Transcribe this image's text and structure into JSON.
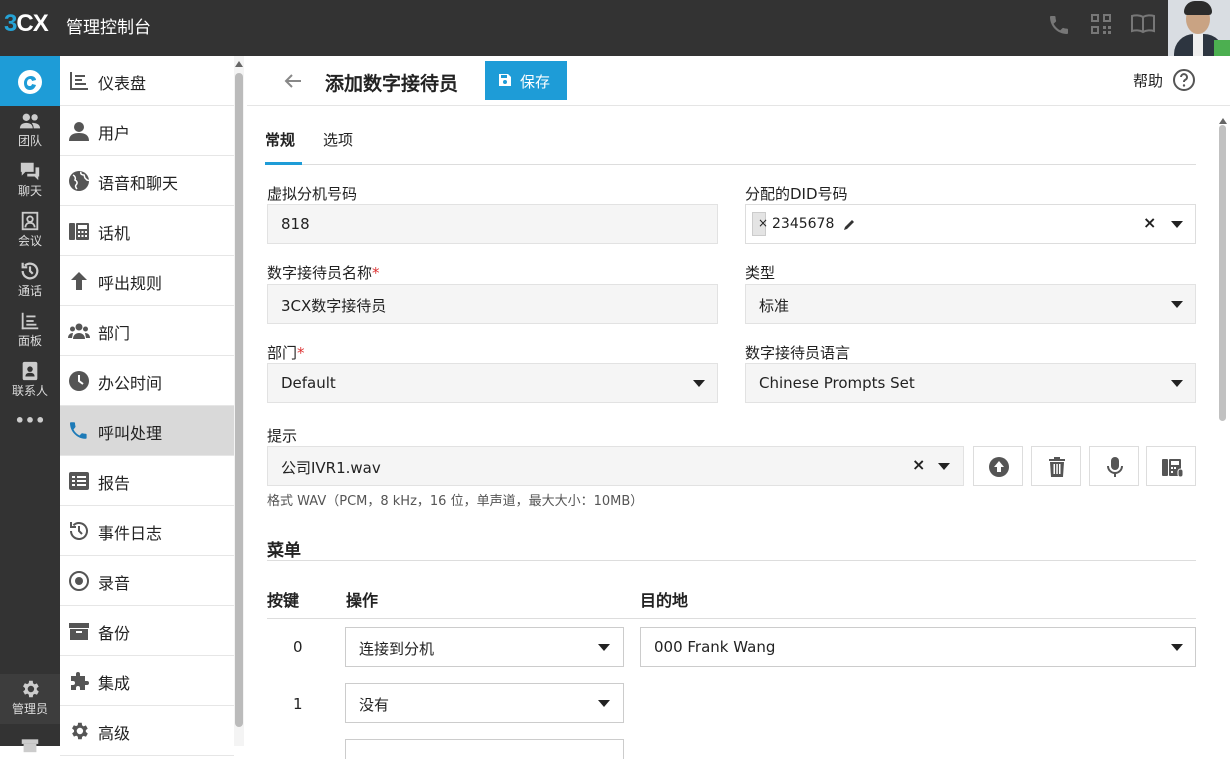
{
  "app": {
    "logo_prefix": "3",
    "logo_suffix": "CX",
    "title": "管理控制台"
  },
  "topbar_icons": [
    "phone-icon",
    "qr-code-icon",
    "book-icon"
  ],
  "rail": {
    "items": [
      {
        "label": "团队",
        "icon": "team-icon"
      },
      {
        "label": "聊天",
        "icon": "chat-icon"
      },
      {
        "label": "会议",
        "icon": "meeting-icon"
      },
      {
        "label": "通话",
        "icon": "history-icon"
      },
      {
        "label": "面板",
        "icon": "panel-icon"
      },
      {
        "label": "联系人",
        "icon": "contacts-icon"
      },
      {
        "label": "•••",
        "icon": "more-icon"
      }
    ],
    "admin_label": "管理员"
  },
  "menu": {
    "items": [
      {
        "label": "仪表盘",
        "icon": "dashboard-icon"
      },
      {
        "label": "用户",
        "icon": "user-icon"
      },
      {
        "label": "语音和聊天",
        "icon": "globe-icon"
      },
      {
        "label": "话机",
        "icon": "desk-phone-icon"
      },
      {
        "label": "呼出规则",
        "icon": "arrow-up-icon"
      },
      {
        "label": "部门",
        "icon": "group-icon"
      },
      {
        "label": "办公时间",
        "icon": "clock-icon"
      },
      {
        "label": "呼叫处理",
        "icon": "phone-icon",
        "active": true
      },
      {
        "label": "报告",
        "icon": "report-icon"
      },
      {
        "label": "事件日志",
        "icon": "history-icon"
      },
      {
        "label": "录音",
        "icon": "record-icon"
      },
      {
        "label": "备份",
        "icon": "archive-icon"
      },
      {
        "label": "集成",
        "icon": "puzzle-icon"
      },
      {
        "label": "高级",
        "icon": "gear-icon"
      }
    ]
  },
  "header": {
    "title": "添加数字接待员",
    "save_label": "保存",
    "help_label": "帮助"
  },
  "tabs": [
    {
      "label": "常规",
      "active": true
    },
    {
      "label": "选项"
    }
  ],
  "form": {
    "extension": {
      "label": "虚拟分机号码",
      "value": "818"
    },
    "did": {
      "label": "分配的DID号码",
      "chip": "2345678"
    },
    "name": {
      "label": "数字接待员名称",
      "value": "3CX数字接待员"
    },
    "type": {
      "label": "类型",
      "value": "标准"
    },
    "department": {
      "label": "部门",
      "value": "Default"
    },
    "language": {
      "label": "数字接待员语言",
      "value": "Chinese Prompts Set"
    },
    "prompt": {
      "label": "提示",
      "value": "公司IVR1.wav",
      "hint": "格式 WAV（PCM，8 kHz，16 位，单声道，最大大小：10MB）"
    }
  },
  "menu_section": {
    "title": "菜单",
    "col_key": "按键",
    "col_action": "操作",
    "col_destination": "目的地",
    "rows": [
      {
        "key": "0",
        "action": "连接到分机",
        "destination": "000 Frank Wang"
      },
      {
        "key": "1",
        "action": "没有",
        "destination": ""
      }
    ]
  }
}
